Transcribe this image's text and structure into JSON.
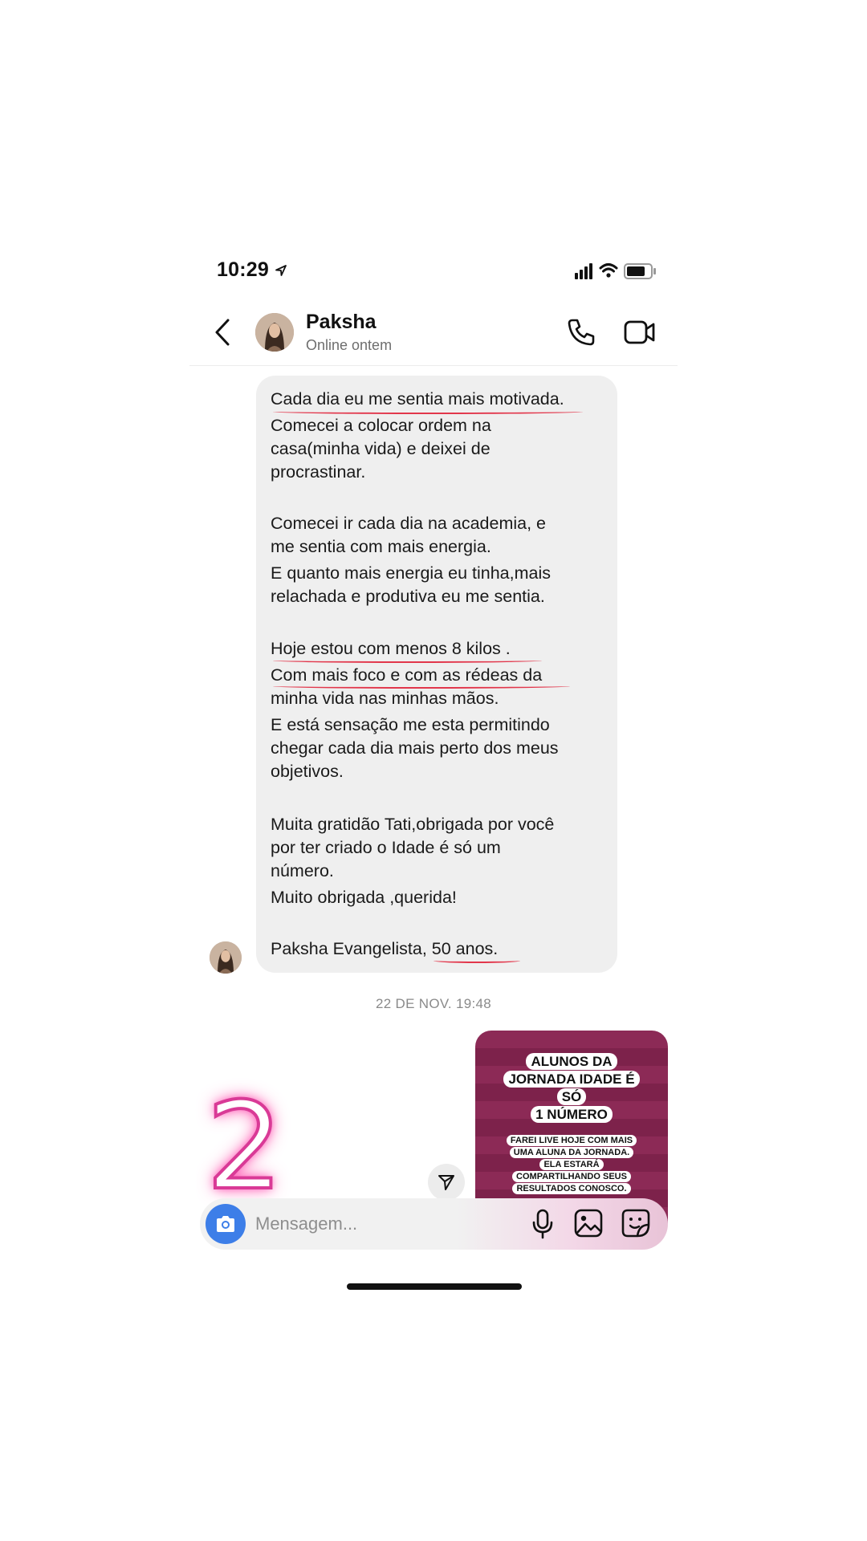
{
  "status_bar": {
    "time": "10:29"
  },
  "header": {
    "contact_name": "Paksha",
    "contact_status": "Online ontem"
  },
  "message": {
    "lines": [
      "Cada dia eu me sentia mais motivada.",
      "Comecei a colocar ordem na",
      "casa(minha vida) e deixei de",
      "procrastinar.",
      "Comecei ir cada  dia na academia, e",
      "me sentia com mais energia.",
      "E quanto mais energia eu tinha,mais",
      "relachada e produtiva eu me sentia.",
      "Hoje estou com menos  8 kilos .",
      "Com mais foco e com as rédeas da",
      "minha vida nas minhas mãos.",
      "E está sensação me esta permitindo",
      "chegar cada dia mais perto dos  meus",
      "objetivos.",
      "Muita gratidão  Tati,obrigada por você",
      "por ter criado o Idade é só um",
      "número.",
      "Muito obrigada ,querida!",
      "Paksha Evangelista, 50 anos."
    ]
  },
  "timestamp": "22 DE NOV. 19:48",
  "story": {
    "title_lines": [
      "ALUNOS DA",
      "JORNADA IDADE É SÓ",
      "1 NÚMERO"
    ],
    "body_lines": [
      "FAREI LIVE HOJE COM MAIS",
      "UMA ALUNA DA JORNADA.",
      "ELA ESTARÁ",
      "COMPARTILHANDO SEUS",
      "RESULTADOS CONOSCO."
    ],
    "colors": {
      "stripe_a": "#8c2a56",
      "stripe_b": "#7d224b"
    }
  },
  "overlay_number": "2",
  "composer": {
    "placeholder": "Mensagem..."
  },
  "colors": {
    "underline": "#e2364b",
    "camera_button": "#3d7ee8",
    "neon": "#d93a96"
  }
}
